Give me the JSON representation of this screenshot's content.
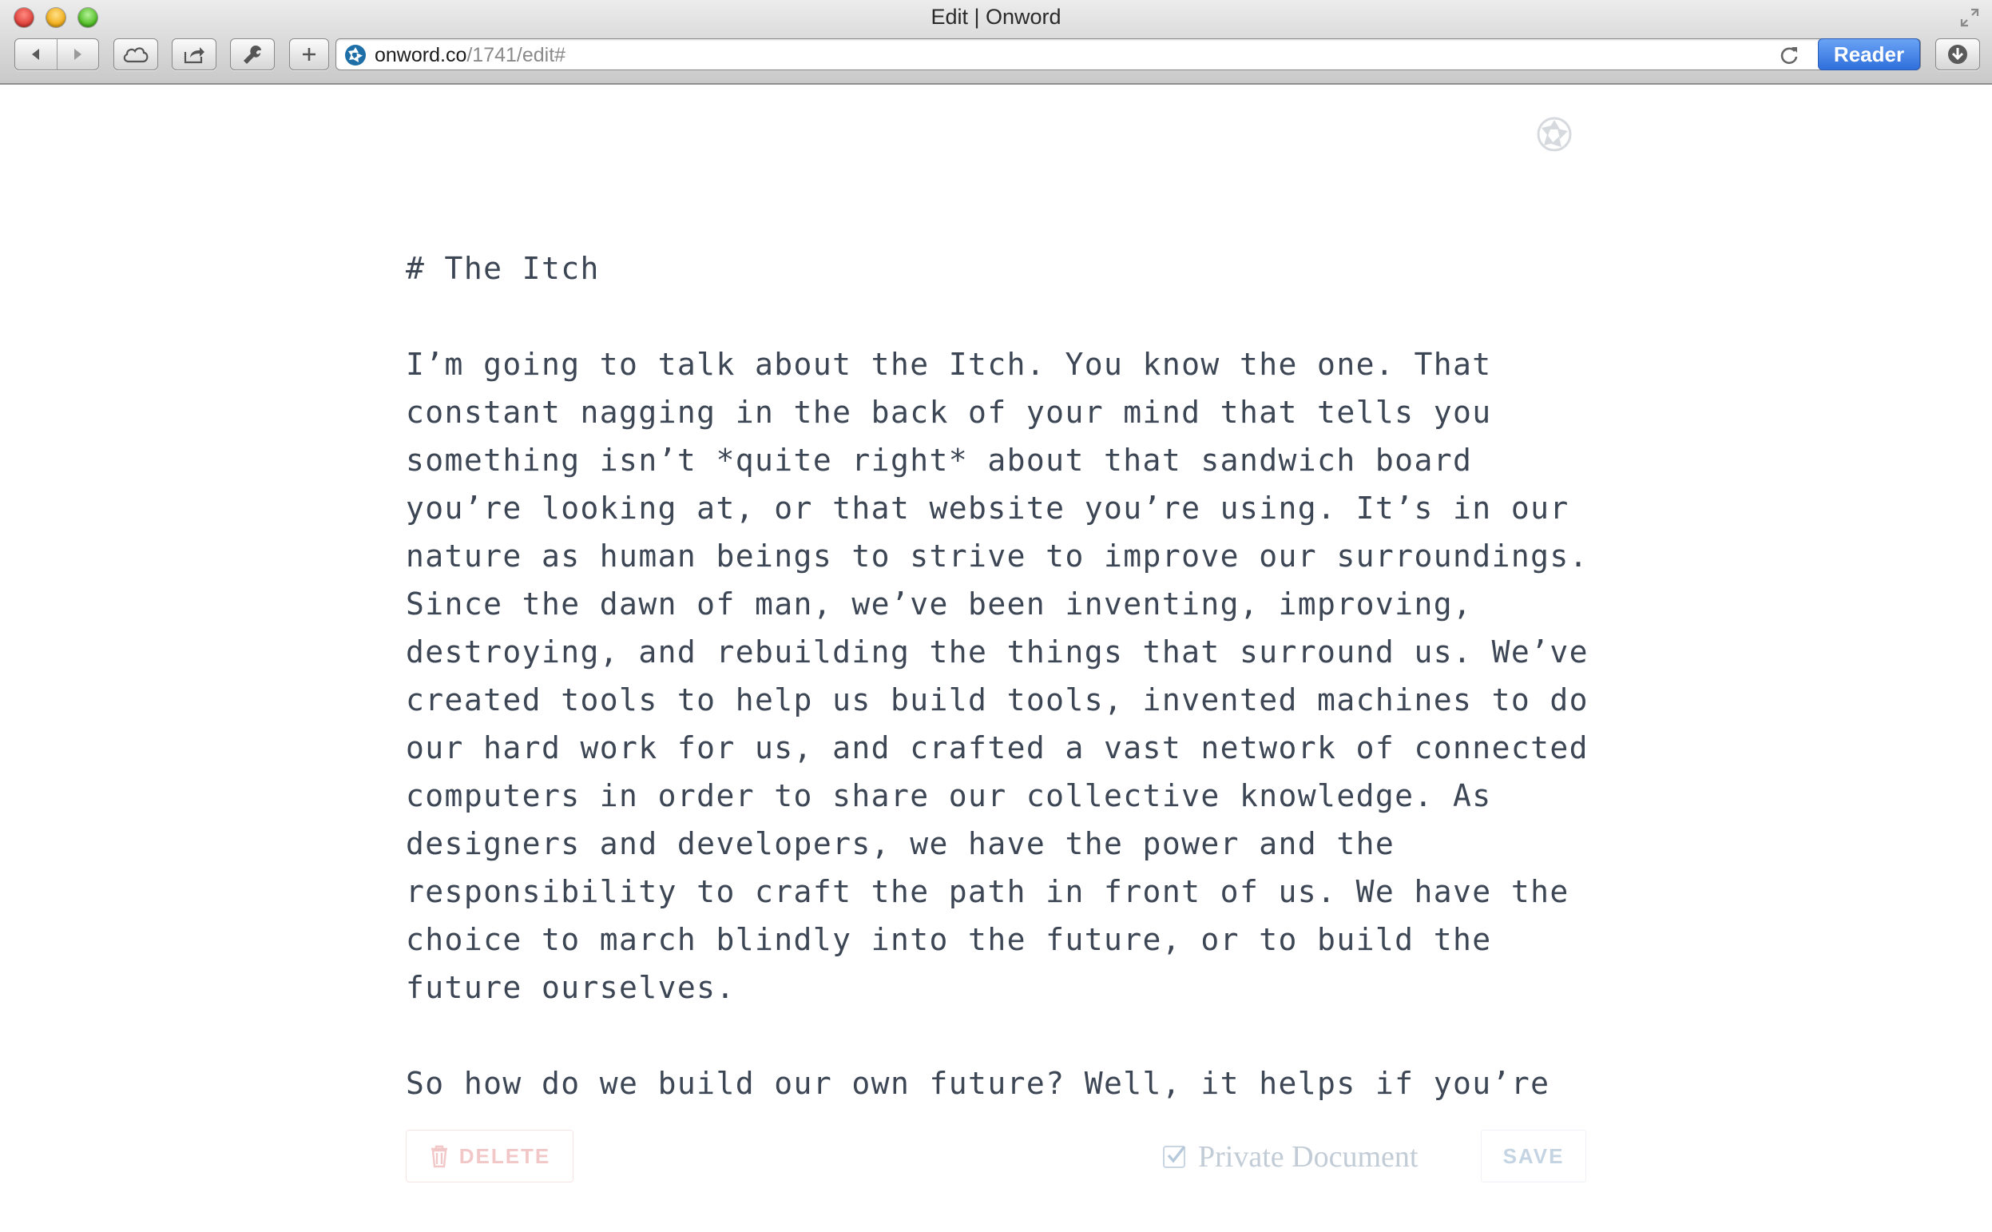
{
  "window": {
    "title": "Edit | Onword"
  },
  "toolbar": {
    "back_icon": "back-arrow-icon",
    "forward_icon": "forward-arrow-icon",
    "cloud_icon": "icloud-tabs-icon",
    "share_icon": "share-icon",
    "tools_icon": "wrench-icon",
    "new_tab_icon": "plus-icon",
    "download_icon": "downloads-icon"
  },
  "address_bar": {
    "domain": "onword.co",
    "path": "/1741/edit#",
    "reader_label": "Reader"
  },
  "editor": {
    "lines": [
      "# The Itch",
      "",
      "I’m going to talk about the Itch. You know the one. That",
      "constant nagging in the back of your mind that tells you",
      "something isn’t *quite right* about that sandwich board",
      "you’re looking at, or that website you’re using. It’s in our",
      "nature as human beings to strive to improve our surroundings.",
      "Since the dawn of man, we’ve been inventing, improving,",
      "destroying, and rebuilding the things that surround us. We’ve",
      "created tools to help us build tools, invented machines to do",
      "our hard work for us, and crafted a vast network of connected",
      "computers in order to share our collective knowledge. As",
      "designers and developers, we have the power and the",
      "responsibility to craft the path in front of us. We have the",
      "choice to march blindly into the future, or to build the",
      "future ourselves.",
      "",
      "So how do we build our own future? Well, it helps if you’re"
    ]
  },
  "actions": {
    "delete_label": "DELETE",
    "private_label": "Private Document",
    "private_checked": true,
    "save_label": "SAVE"
  },
  "colors": {
    "text": "#3c4654",
    "delete": "#f2c7c7",
    "save": "#c4d4e3",
    "reader": "#2f6fdb"
  }
}
